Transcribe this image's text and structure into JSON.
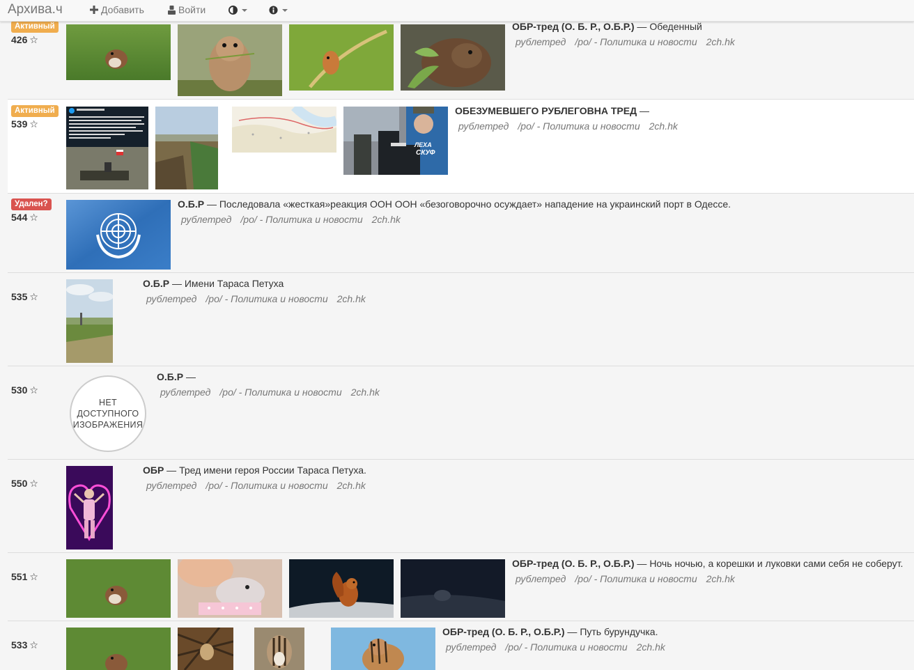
{
  "nav": {
    "brand": "Архива.ч",
    "add_label": "Добавить",
    "login_label": "Войти"
  },
  "threads": [
    {
      "badge": "Активный",
      "score": "426",
      "subject": "ОБР-тред (О. Б. Р., О.Б.Р.)",
      "separator": " — ",
      "comment": "Обеденный",
      "tags": [
        "рублетред",
        "/po/ - Политика и новости",
        "2ch.hk"
      ],
      "thumbs": [
        "hamster-on-grass",
        "gopher-eating-grass",
        "mouse-on-wheat",
        "beaver-eating-leaves"
      ]
    },
    {
      "badge": "Активный",
      "score": "539",
      "subject": "ОБЕЗУМЕВШЕГО РУБЛЕГОВНА ТРЕД",
      "separator": " — ",
      "comment": "",
      "tags": [
        "рублетред",
        "/po/ - Политика и новости",
        "2ch.hk"
      ],
      "thumbs": [
        "news-tweet-screenshot",
        "village-garden",
        "frontline-map",
        "soldiers-poster"
      ]
    },
    {
      "badge": "Удален?",
      "score": "544",
      "subject": "О.Б.Р",
      "separator": " — ",
      "comment": "Последовала «жесткая»реакция ООН ООН «безоговорочно осуждает» нападение на украинский порт в Одессе.",
      "tags": [
        "рублетред",
        "/po/ - Политика и новости",
        "2ch.hk"
      ],
      "thumbs": [
        "un-flag"
      ]
    },
    {
      "badge": "",
      "score": "535",
      "subject": "О.Б.Р",
      "separator": " — ",
      "comment": "Имени Тараса Петуха",
      "tags": [
        "рублетред",
        "/po/ - Политика и новости",
        "2ch.hk"
      ],
      "thumbs": [
        "field-landscape"
      ]
    },
    {
      "badge": "",
      "score": "530",
      "subject": "О.Б.Р",
      "separator": " — ",
      "comment": "",
      "tags": [
        "рублетред",
        "/po/ - Политика и новости",
        "2ch.hk"
      ],
      "placeholder": [
        "НЕТ",
        "ДОСТУПНОГО",
        "ИЗОБРАЖЕНИЯ"
      ]
    },
    {
      "badge": "",
      "score": "550",
      "subject": "ОБР",
      "separator": " — ",
      "comment": "Тред имени героя России Тараса Петуха.",
      "tags": [
        "рублетред",
        "/po/ - Политика и новости",
        "2ch.hk"
      ],
      "thumbs": [
        "neon-heart-dancer"
      ]
    },
    {
      "badge": "",
      "score": "551",
      "subject": "ОБР-тред (О. Б. Р., О.Б.Р.)",
      "separator": " — ",
      "comment": "Ночь ночью, а корешки и луковки сами себя не соберут.",
      "tags": [
        "рублетред",
        "/po/ - Политика и новости",
        "2ch.hk"
      ],
      "thumbs": [
        "hamster-on-grass",
        "hamster-in-hand",
        "squirrel-at-night",
        "dark-night-animal"
      ]
    },
    {
      "badge": "",
      "score": "533",
      "subject": "ОБР-тред (О. Б. Р., О.Б.Р.)",
      "separator": " — ",
      "comment": "Путь бурундучка.",
      "tags": [
        "рублетред",
        "/po/ - Политика и новости",
        "2ch.hk"
      ],
      "thumbs": [
        "hamster-on-grass",
        "chipmunk-in-branches",
        "chipmunk-closeup",
        "chipmunk-on-rock"
      ]
    }
  ],
  "colors": {
    "badge_active": "#f0ad4e",
    "badge_deleted": "#d9534f",
    "tag_text": "#777777"
  }
}
